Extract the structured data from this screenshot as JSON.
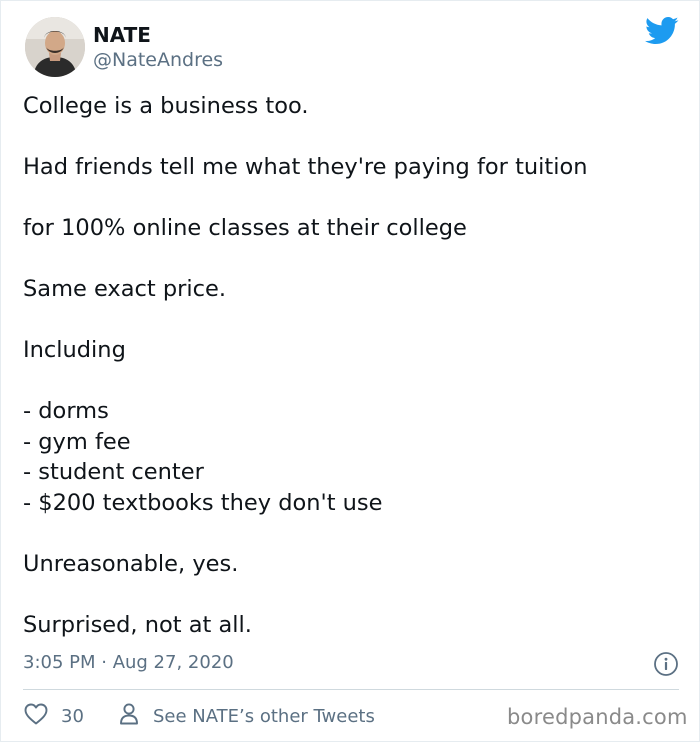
{
  "author": {
    "name": "NATE",
    "handle": "@NateAndres"
  },
  "tweet": {
    "lines": [
      "College is a business too.",
      "",
      "Had friends tell me what they're paying for tuition",
      "",
      "for 100% online classes at their college",
      "",
      "Same exact price.",
      "",
      "Including",
      "",
      "- dorms",
      "- gym fee",
      "- student center",
      "- $200 textbooks they don't use",
      "",
      "Unreasonable, yes.",
      "",
      "Surprised, not at all."
    ]
  },
  "meta": {
    "timestamp": "3:05 PM · Aug 27, 2020"
  },
  "actions": {
    "like_count": "30",
    "other_tweets_label": "See NATE’s other Tweets"
  },
  "watermark": "boredpanda.com",
  "colors": {
    "twitter_blue": "#1d9bf0",
    "secondary_text": "#5b7083",
    "divider": "#cfd9de"
  },
  "icons": {
    "brand": "twitter-bird-icon",
    "info": "info-icon",
    "like": "heart-icon",
    "profile": "person-icon"
  }
}
